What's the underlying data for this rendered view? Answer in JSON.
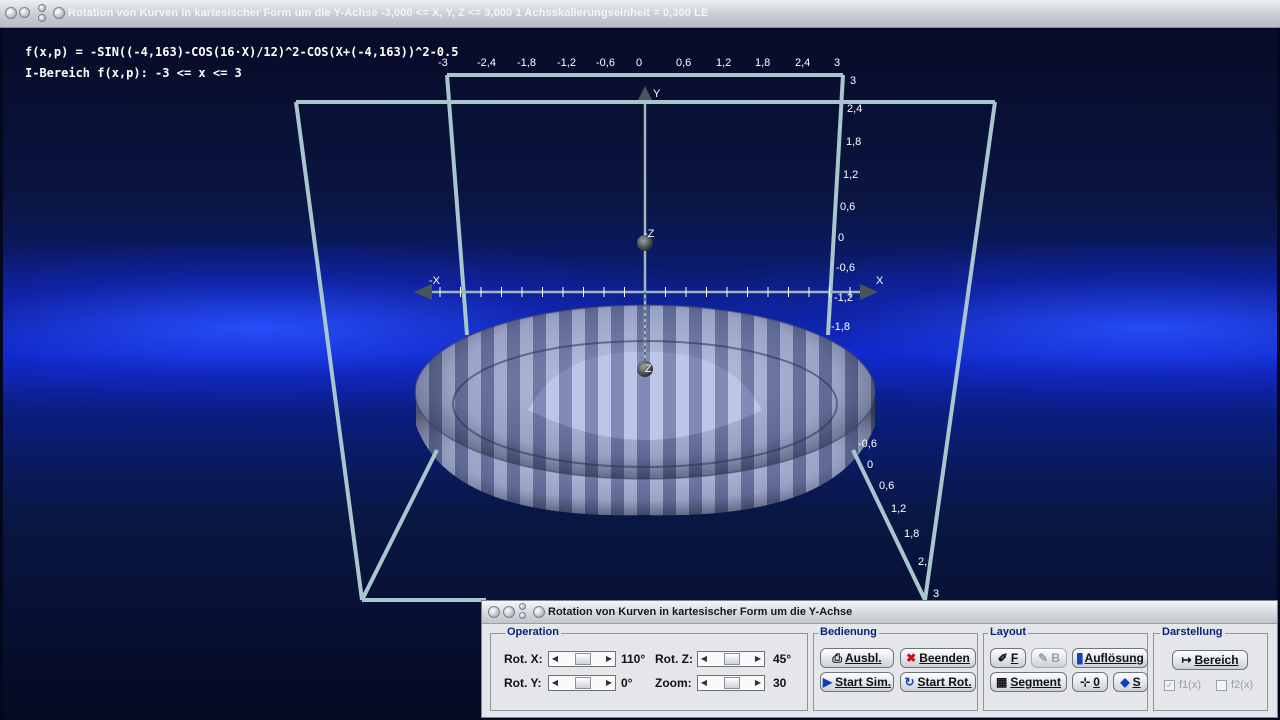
{
  "window": {
    "title": "Rotation von Kurven in kartesischer Form um die Y-Achse   -3,000 <= X, Y, Z <= 3,000   1 Achsskalierungseinheit = 0,300 LE"
  },
  "info": {
    "function": "f(x,p) = -SIN((-4,163)-COS(16·X)/12)^2-COS(X+(-4,163))^2-0.5",
    "range": "I-Bereich f(x,p): -3 <= x <= 3"
  },
  "axes": {
    "x_label": "X",
    "x_neg_label": "-X",
    "y_label": "Y",
    "z_label": "Z",
    "z_neg_label": "-Z",
    "top_ticks": [
      "-3",
      "-2,4",
      "-1,8",
      "-1,2",
      "-0,6",
      "0",
      "0,6",
      "1,2",
      "1,8",
      "2,4",
      "3"
    ],
    "right_ticks": [
      "3",
      "2,4",
      "1,8",
      "1,2",
      "0,6",
      "0",
      "-0,6",
      "-1,2",
      "-1,8"
    ],
    "depth_ticks": [
      "-0,6",
      "0",
      "0,6",
      "1,2",
      "1,8",
      "2,",
      "3"
    ]
  },
  "controls": {
    "title": "Rotation von Kurven in kartesischer Form um die Y-Achse",
    "operation": {
      "label": "Operation",
      "rot_x_label": "Rot. X:",
      "rot_x_value": "110°",
      "rot_y_label": "Rot. Y:",
      "rot_y_value": "0°",
      "rot_z_label": "Rot. Z:",
      "rot_z_value": "45°",
      "zoom_label": "Zoom:",
      "zoom_value": "30"
    },
    "bedienung": {
      "label": "Bedienung",
      "ausbl": "Ausbl.",
      "beenden": "Beenden",
      "start_sim": "Start Sim.",
      "start_rot": "Start Rot."
    },
    "layout": {
      "label": "Layout",
      "f": "F",
      "b": "B",
      "aufloesung": "Auflösung",
      "segment": "Segment",
      "zero": "0",
      "s": "S"
    },
    "darstellung": {
      "label": "Darstellung",
      "bereich": "Bereich",
      "f1": "f1(x)",
      "f2": "f2(x)"
    }
  },
  "colors": {
    "accent": "#0b1f7a",
    "surface": "#8f9cc9",
    "frame": "#a9c6cf"
  }
}
